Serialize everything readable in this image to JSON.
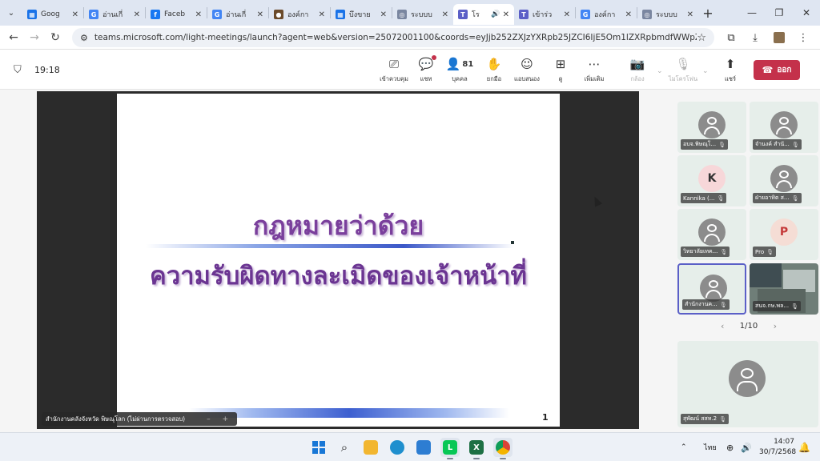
{
  "browser": {
    "tabs": [
      {
        "title": "Goog",
        "fav_color": "#1a73e8",
        "fav_glyph": "▦",
        "active": false
      },
      {
        "title": "อ่านเกี่",
        "fav_color": "#4285f4",
        "fav_glyph": "G",
        "active": false
      },
      {
        "title": "Faceb",
        "fav_color": "#1877f2",
        "fav_glyph": "f",
        "active": false
      },
      {
        "title": "อ่านเกี่",
        "fav_color": "#4285f4",
        "fav_glyph": "G",
        "active": false
      },
      {
        "title": "องค์กา",
        "fav_color": "#6b4a2a",
        "fav_glyph": "●",
        "active": false
      },
      {
        "title": "บึงขาย",
        "fav_color": "#1a73e8",
        "fav_glyph": "▦",
        "active": false
      },
      {
        "title": "ระบบบ",
        "fav_color": "#7a86a0",
        "fav_glyph": "◎",
        "active": false
      },
      {
        "title": "โร",
        "fav_color": "#5b5fc7",
        "fav_glyph": "T",
        "active": true,
        "speaker": "🔊"
      },
      {
        "title": "เข้าร่ว",
        "fav_color": "#5b5fc7",
        "fav_glyph": "T",
        "active": false
      },
      {
        "title": "องค์กา",
        "fav_color": "#4285f4",
        "fav_glyph": "G",
        "active": false
      },
      {
        "title": "ระบบบ",
        "fav_color": "#7a86a0",
        "fav_glyph": "◎",
        "active": false
      }
    ],
    "new_tab_glyph": "+",
    "url": "teams.microsoft.com/light-meetings/launch?agent=web&version=25072001100&coords=eyJjb252ZXJzYXRpb25JZCI6IjE5Om1lZXRpbmdfWWpZeE16TTFZamt..."
  },
  "teams": {
    "timer": "19:18",
    "toolbar": [
      {
        "label": "เข้าควบคุม",
        "icon": "⎚",
        "name": "take-control"
      },
      {
        "label": "แชท",
        "icon": "💬",
        "name": "chat",
        "badge": true
      },
      {
        "label": "บุคคล",
        "icon": "👤",
        "name": "people",
        "count": "81"
      },
      {
        "label": "ยกมือ",
        "icon": "✋",
        "name": "raise-hand"
      },
      {
        "label": "แอบสนอง",
        "icon": "☺",
        "name": "react"
      },
      {
        "label": "ดู",
        "icon": "⊞",
        "name": "view"
      },
      {
        "label": "เพิ่มเติม",
        "icon": "⋯",
        "name": "more"
      },
      {
        "label": "กล้อง",
        "icon": "📷",
        "name": "camera",
        "dim": true
      },
      {
        "label": "ไมโครโฟน",
        "icon": "🎙",
        "name": "mic",
        "dim": true
      },
      {
        "label": "แชร์",
        "icon": "⬆",
        "name": "share"
      }
    ],
    "leave_label": "ออก"
  },
  "slide": {
    "title_line1": "กฎหมายว่าด้วย",
    "title_line2": "ความรับผิดทางละเมิดของเจ้าหน้าที่",
    "page_number": "1"
  },
  "presenter": {
    "name": "สำนักงานคลังจังหวัด พิษณุโลก (ไม่ผ่านการตรวจสอบ)",
    "controls": "– +"
  },
  "participants": [
    {
      "name": "อบจ.พิษณุโ...",
      "initial": "",
      "style": "grey"
    },
    {
      "name": "จำนงค์ สำนั...",
      "initial": "",
      "style": "grey"
    },
    {
      "name": "Kannika (...",
      "initial": "K",
      "style": "light"
    },
    {
      "name": "ฝ่ายอาทิต ส...",
      "initial": "",
      "style": "grey"
    },
    {
      "name": "วิทยาลัยเทค...",
      "initial": "",
      "style": "grey"
    },
    {
      "name": "Pro",
      "initial": "P",
      "style": "peach"
    },
    {
      "name": "สำนักงานค...",
      "initial": "",
      "style": "grey",
      "selected": true
    },
    {
      "name": "สนจ.กษ.พล...",
      "initial": "",
      "style": "video"
    }
  ],
  "pager": {
    "label": "1/10"
  },
  "spotlight": {
    "name": "สุพัฒน์ สสท.2"
  },
  "taskbar": {
    "tray_lang": "ไทย",
    "time": "14:07",
    "date": "30/7/2568"
  }
}
